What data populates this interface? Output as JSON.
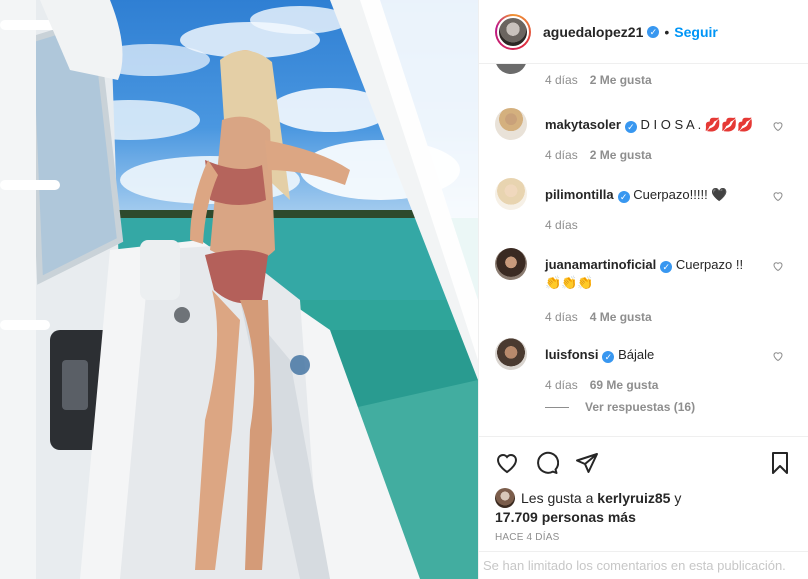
{
  "header": {
    "username": "aguedalopez21",
    "verified_mark": "✓",
    "separator": "•",
    "follow_label": "Seguir"
  },
  "comments": [
    {
      "user": "",
      "text": "",
      "time": "4 días",
      "likes": "2 Me gusta",
      "avatar": "avatar-partial"
    },
    {
      "user": "makytasoler",
      "text": "D I O S A . 💋💋💋",
      "time": "4 días",
      "likes": "2 Me gusta",
      "avatar": "avatar-blonde-woman"
    },
    {
      "user": "pilimontilla",
      "text": "Cuerpazo!!!!! 🖤",
      "time": "4 días",
      "likes": "",
      "avatar": "avatar-light-hair-woman"
    },
    {
      "user": "juanamartinoficial",
      "text": "Cuerpazo !! 👏👏👏",
      "time": "4 días",
      "likes": "4 Me gusta",
      "avatar": "avatar-dark-hair-woman"
    },
    {
      "user": "luisfonsi",
      "text": "Bájale",
      "time": "4 días",
      "likes": "69 Me gusta",
      "avatar": "avatar-bearded-man"
    }
  ],
  "replies_label": "Ver respuestas (16)",
  "likes": {
    "prefix": "Les gusta a",
    "user": "kerlyruiz85",
    "conj": "y",
    "count": "17.709 personas más"
  },
  "post_date": "HACE 4 DÍAS",
  "comments_limited": "Se han limitado los comentarios en esta publicación.",
  "colors": {
    "accent": "#0095f6",
    "verified": "#3897f0",
    "muted": "#8e8e8e"
  },
  "icons": [
    "heart-icon",
    "comment-icon",
    "share-icon",
    "bookmark-icon"
  ]
}
